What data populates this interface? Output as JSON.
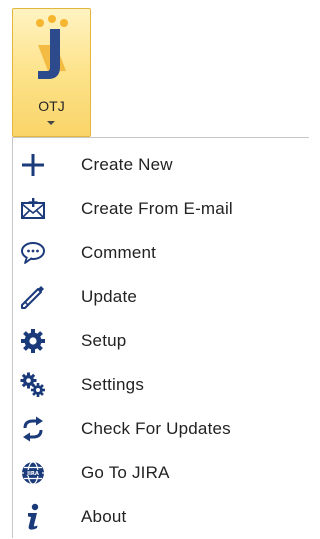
{
  "ribbon": {
    "label": "OTJ",
    "logo_icon": "jira-logo-icon",
    "button_colors": [
      "#fff3c2",
      "#f9d468"
    ]
  },
  "menu": {
    "items": [
      {
        "label": "Create New",
        "icon": "plus-icon"
      },
      {
        "label": "Create From E-mail",
        "icon": "envelope-icon"
      },
      {
        "label": "Comment",
        "icon": "speech-bubble-icon"
      },
      {
        "label": "Update",
        "icon": "pencil-icon"
      },
      {
        "label": "Setup",
        "icon": "gear-icon"
      },
      {
        "label": "Settings",
        "icon": "gears-icon"
      },
      {
        "label": "Check For Updates",
        "icon": "refresh-arrows-icon"
      },
      {
        "label": "Go To JIRA",
        "icon": "globe-icon"
      },
      {
        "label": "About",
        "icon": "info-icon"
      }
    ]
  }
}
